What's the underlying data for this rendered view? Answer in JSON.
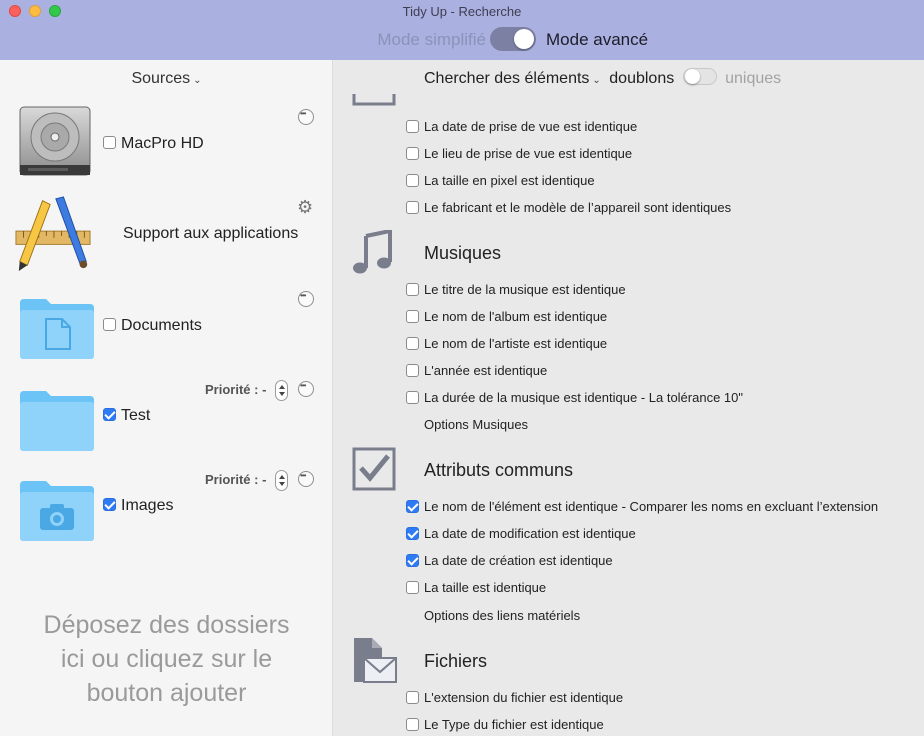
{
  "window": {
    "title": "Tidy Up - Recherche"
  },
  "mode": {
    "left_label": "Mode simplifié",
    "right_label": "Mode avancé"
  },
  "sidebar": {
    "header": "Sources",
    "items": [
      {
        "label": "MacPro HD",
        "checked": false,
        "icon": "hard-drive-icon"
      },
      {
        "label": "Support aux applications",
        "icon": "applications-icon"
      },
      {
        "label": "Documents",
        "checked": false,
        "icon": "documents-folder-icon"
      },
      {
        "label": "Test",
        "checked": true,
        "priority": "Priorité : -",
        "icon": "folder-icon"
      },
      {
        "label": "Images",
        "checked": true,
        "priority": "Priorité : -",
        "icon": "images-folder-icon"
      }
    ],
    "drop_hint_lines": [
      "Déposez des dossiers",
      "ici ou cliquez sur le",
      "bouton ajouter"
    ]
  },
  "main": {
    "search": {
      "label": "Chercher des éléments",
      "duplicates": "doublons",
      "uniques": "uniques"
    },
    "photo_options": [
      "La date de prise de vue est identique",
      "Le lieu de prise de vue est identique",
      "La taille en pixel est identique",
      "Le fabricant et le modèle de l’appareil sont identiques"
    ],
    "music": {
      "title": "Musiques",
      "options": [
        "Le titre de la musique est identique",
        "Le nom de l'album est identique",
        "Le nom de l'artiste est identique",
        "L'année est identique",
        "La durée de la musique est identique - La tolérance 10\""
      ],
      "link": "Options Musiques"
    },
    "common": {
      "title": "Attributs communs",
      "options": [
        "Le nom de l'élément est identique - Comparer les noms en excluant l’extension",
        "La date de modification est identique",
        "La date de création est identique",
        "La taille est identique"
      ],
      "link": "Options des liens matériels"
    },
    "files": {
      "title": "Fichiers",
      "options": [
        "L'extension du fichier est identique",
        "Le Type du fichier est identique"
      ]
    }
  }
}
